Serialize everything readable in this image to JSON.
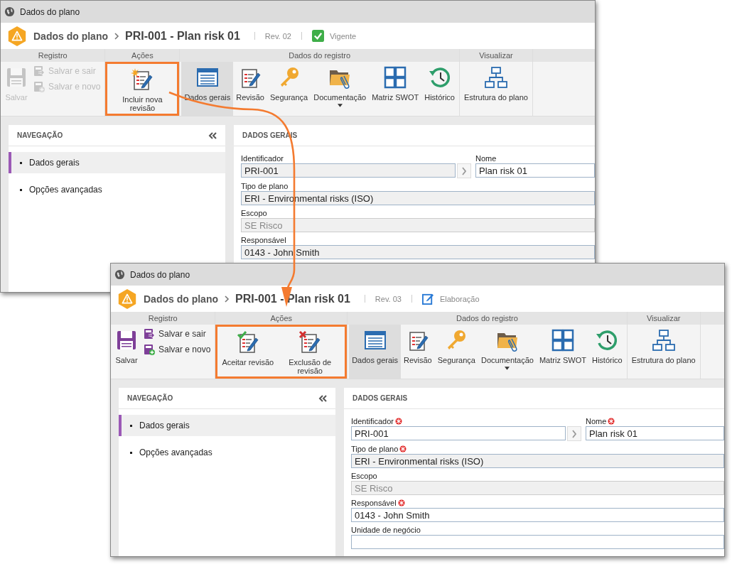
{
  "windows": [
    {
      "title": "Dados do plano",
      "header": {
        "breadcrumb": "Dados do plano",
        "record": "PRI-001 - Plan risk 01",
        "revision": "Rev. 02",
        "status": {
          "kind": "approved",
          "label": "Vigente"
        }
      },
      "ribbon": [
        {
          "title": "Registro",
          "kind": "register",
          "highlighted": false,
          "items": [
            {
              "kind": "save",
              "label": "Salvar",
              "disabled": true
            },
            {
              "kind": "save-exit",
              "label": "Salvar e sair",
              "disabled": true
            },
            {
              "kind": "save-new",
              "label": "Salvar e novo",
              "disabled": true
            }
          ]
        },
        {
          "title": "Ações",
          "kind": "actions",
          "highlighted": true,
          "items": [
            {
              "kind": "add-revision",
              "label": "Incluir nova revisão",
              "disabled": false
            }
          ]
        },
        {
          "title": "Dados do registro",
          "kind": "data",
          "highlighted": false,
          "items": [
            {
              "kind": "form",
              "label": "Dados gerais",
              "disabled": false,
              "selected": true
            },
            {
              "kind": "revision",
              "label": "Revisão",
              "disabled": false,
              "selected": false
            },
            {
              "kind": "key",
              "label": "Segurança",
              "disabled": false,
              "selected": false
            },
            {
              "kind": "folder",
              "label": "Documentação",
              "disabled": false,
              "selected": false,
              "dropdown": true
            },
            {
              "kind": "grid",
              "label": "Matriz SWOT",
              "disabled": false,
              "selected": false
            },
            {
              "kind": "history",
              "label": "Histórico",
              "disabled": false,
              "selected": false
            }
          ]
        },
        {
          "title": "Visualizar",
          "kind": "view",
          "highlighted": false,
          "items": [
            {
              "kind": "tree",
              "label": "Estrutura do plano",
              "disabled": false
            }
          ]
        }
      ],
      "navigation": {
        "title": "NAVEGAÇÃO",
        "items": [
          {
            "label": "Dados gerais",
            "selected": true
          },
          {
            "label": "Opções avançadas",
            "selected": false
          }
        ]
      },
      "form": {
        "title": "DADOS GERAIS",
        "rows": [
          [
            {
              "label": "Identificador",
              "kind": "lookup",
              "value": "PRI-001",
              "required": false,
              "readonly": true,
              "disabled": false
            },
            {
              "label": "Nome",
              "kind": "text",
              "value": "Plan risk 01",
              "required": false,
              "readonly": false,
              "disabled": false
            }
          ],
          [
            {
              "label": "Tipo de plano",
              "kind": "text",
              "value": "ERI - Environmental risks (ISO)",
              "required": false,
              "readonly": true,
              "disabled": false
            }
          ],
          [
            {
              "label": "Escopo",
              "kind": "text",
              "value": "SE Risco",
              "required": false,
              "readonly": true,
              "disabled": true
            }
          ],
          [
            {
              "label": "Responsável",
              "kind": "text",
              "value": "0143 - John Smith",
              "required": false,
              "readonly": true,
              "disabled": false
            }
          ]
        ]
      }
    },
    {
      "title": "Dados do plano",
      "header": {
        "breadcrumb": "Dados do plano",
        "record": "PRI-001 - Plan risk 01",
        "revision": "Rev. 03",
        "status": {
          "kind": "editing",
          "label": "Elaboração"
        }
      },
      "ribbon": [
        {
          "title": "Registro",
          "kind": "register",
          "highlighted": false,
          "items": [
            {
              "kind": "save",
              "label": "Salvar",
              "disabled": false
            },
            {
              "kind": "save-exit",
              "label": "Salvar e sair",
              "disabled": false
            },
            {
              "kind": "save-new",
              "label": "Salvar e novo",
              "disabled": false
            }
          ]
        },
        {
          "title": "Ações",
          "kind": "actions",
          "highlighted": true,
          "items": [
            {
              "kind": "accept-revision",
              "label": "Aceitar revisão",
              "disabled": false
            },
            {
              "kind": "delete-revision",
              "label": "Exclusão de revisão",
              "disabled": false
            }
          ]
        },
        {
          "title": "Dados do registro",
          "kind": "data",
          "highlighted": false,
          "items": [
            {
              "kind": "form",
              "label": "Dados gerais",
              "disabled": false,
              "selected": true
            },
            {
              "kind": "revision",
              "label": "Revisão",
              "disabled": false,
              "selected": false
            },
            {
              "kind": "key",
              "label": "Segurança",
              "disabled": false,
              "selected": false
            },
            {
              "kind": "folder",
              "label": "Documentação",
              "disabled": false,
              "selected": false,
              "dropdown": true
            },
            {
              "kind": "grid",
              "label": "Matriz SWOT",
              "disabled": false,
              "selected": false
            },
            {
              "kind": "history",
              "label": "Histórico",
              "disabled": false,
              "selected": false
            }
          ]
        },
        {
          "title": "Visualizar",
          "kind": "view",
          "highlighted": false,
          "items": [
            {
              "kind": "tree",
              "label": "Estrutura do plano",
              "disabled": false
            }
          ]
        }
      ],
      "navigation": {
        "title": "NAVEGAÇÃO",
        "items": [
          {
            "label": "Dados gerais",
            "selected": true
          },
          {
            "label": "Opções avançadas",
            "selected": false
          }
        ]
      },
      "form": {
        "title": "DADOS GERAIS",
        "rows": [
          [
            {
              "label": "Identificador",
              "kind": "lookup",
              "value": "PRI-001",
              "required": true,
              "readonly": false,
              "disabled": false
            },
            {
              "label": "Nome",
              "kind": "text",
              "value": "Plan risk 01",
              "required": true,
              "readonly": false,
              "disabled": false
            }
          ],
          [
            {
              "label": "Tipo de plano",
              "kind": "text",
              "value": "ERI - Environmental risks (ISO)",
              "required": true,
              "readonly": true,
              "disabled": false
            }
          ],
          [
            {
              "label": "Escopo",
              "kind": "text",
              "value": "SE Risco",
              "required": false,
              "readonly": true,
              "disabled": true
            }
          ],
          [
            {
              "label": "Responsável",
              "kind": "text",
              "value": "0143 - John Smith",
              "required": true,
              "readonly": false,
              "disabled": false
            }
          ],
          [
            {
              "label": "Unidade de negócio",
              "kind": "text",
              "required": false,
              "readonly": false,
              "disabled": false
            }
          ]
        ]
      }
    }
  ]
}
